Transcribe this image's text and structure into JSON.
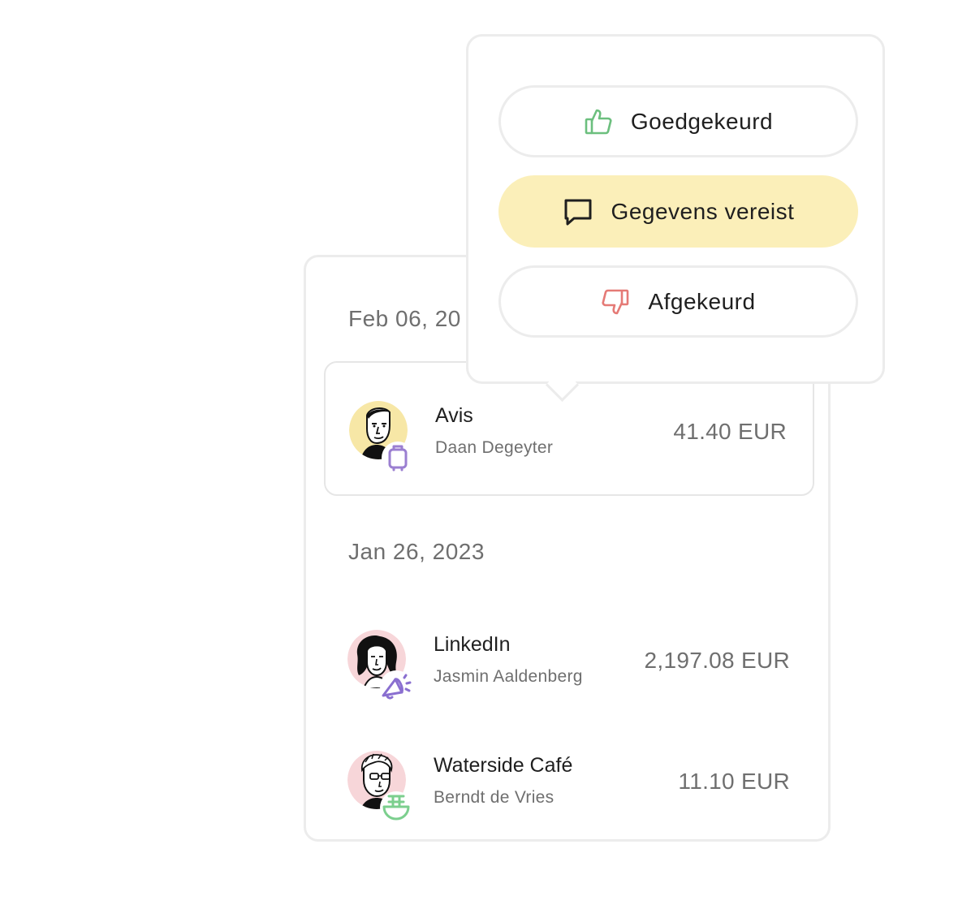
{
  "status_menu": {
    "options": [
      {
        "label": "Goedgekeurd",
        "icon": "thumbs-up-icon",
        "icon_color": "#6cbf7e"
      },
      {
        "label": "Gegevens vereist",
        "icon": "message-icon",
        "icon_color": "#1f1f1f",
        "highlight_color": "#fbefb9"
      },
      {
        "label": "Afgekeurd",
        "icon": "thumbs-down-icon",
        "icon_color": "#e57a76"
      }
    ]
  },
  "transactions": {
    "groups": [
      {
        "date": "Feb 06, 20",
        "items": [
          {
            "merchant": "Avis",
            "person": "Daan Degeyter",
            "amount": "41.40 EUR",
            "category_icon": "suitcase-icon",
            "avatar_color": "#f7e7a6",
            "category_color": "#9b7fd1"
          }
        ]
      },
      {
        "date": "Jan 26, 2023",
        "items": [
          {
            "merchant": "LinkedIn",
            "person": "Jasmin Aaldenberg",
            "amount": "2,197.08 EUR",
            "category_icon": "megaphone-icon",
            "avatar_color": "#f7d6d9",
            "category_color": "#8a6fd0"
          },
          {
            "merchant": "Waterside Café",
            "person": "Berndt de Vries",
            "amount": "11.10 EUR",
            "category_icon": "food-bowl-icon",
            "avatar_color": "#f7d6d9",
            "category_color": "#7ccf8e"
          }
        ]
      }
    ]
  }
}
